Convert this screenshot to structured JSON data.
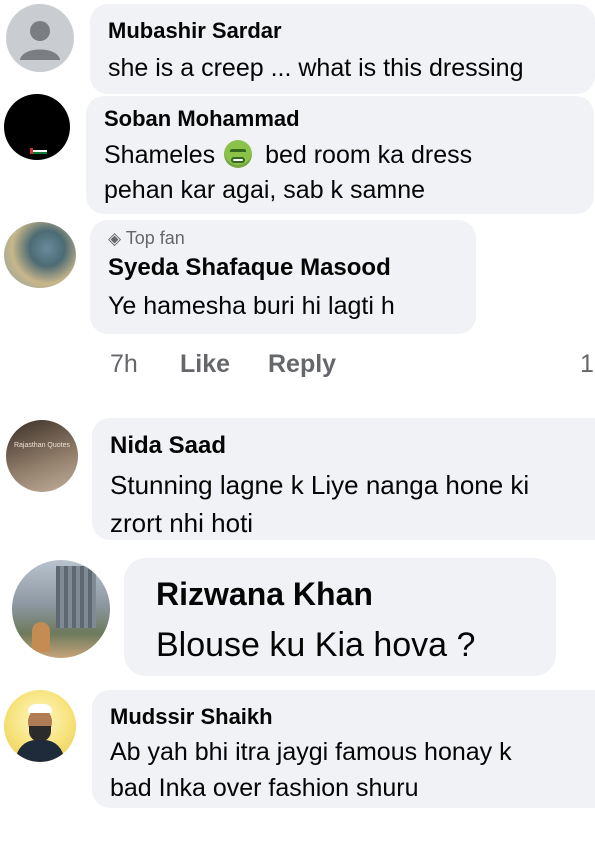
{
  "comments": [
    {
      "name": "Mubashir Sardar",
      "lines": [
        "she is a creep ... what is this dressing"
      ]
    },
    {
      "name": "Soban Mohammad",
      "line1_before": "Shameles",
      "emoji": "nauseated-face",
      "line1_after": "bed room ka dress",
      "line2": "pehan kar agai, sab k samne"
    },
    {
      "badge": "Top fan",
      "name": "Syeda Shafaque Masood",
      "lines": [
        "Ye hamesha buri hi lagti h"
      ],
      "actions": {
        "time": "7h",
        "like": "Like",
        "reply": "Reply",
        "count": "1"
      }
    },
    {
      "name": "Nida Saad",
      "lines": [
        "Stunning lagne k Liye nanga hone ki",
        "zrort nhi hoti"
      ],
      "avatar_text": "Rajasthan Quotes"
    },
    {
      "name": "Rizwana Khan",
      "lines": [
        "Blouse ku Kia hova ?"
      ]
    },
    {
      "name": "Mudssir Shaikh",
      "lines": [
        "Ab yah bhi itra jaygi famous honay k",
        "bad Inka over fashion shuru"
      ]
    }
  ]
}
